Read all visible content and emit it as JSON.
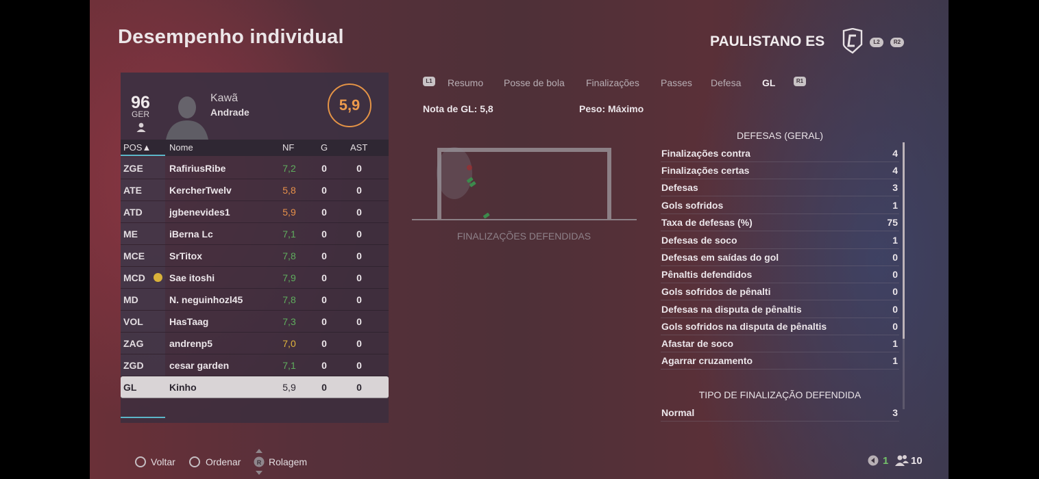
{
  "header": {
    "title": "Desempenho individual",
    "team": "PAULISTANO ES",
    "l2": "L2",
    "r2": "R2"
  },
  "player": {
    "overall": "96",
    "position": "GER",
    "first_name": "Kawã",
    "last_name": "Andrade",
    "rating": "5,9"
  },
  "table": {
    "headers": {
      "pos": "POS▲",
      "name": "Nome",
      "nf": "NF",
      "g": "G",
      "ast": "AST"
    },
    "rows": [
      {
        "pos": "ZGE",
        "name": "RafiriusRibe",
        "nf": "7,2",
        "g": "0",
        "ast": "0"
      },
      {
        "pos": "ATE",
        "name": "KercherTwelv",
        "nf": "5,8",
        "g": "0",
        "ast": "0"
      },
      {
        "pos": "ATD",
        "name": "jgbenevides1",
        "nf": "5,9",
        "g": "0",
        "ast": "0"
      },
      {
        "pos": "ME",
        "name": "iBerna Lc",
        "nf": "7,1",
        "g": "0",
        "ast": "0"
      },
      {
        "pos": "MCE",
        "name": "SrTitox",
        "nf": "7,8",
        "g": "0",
        "ast": "0"
      },
      {
        "pos": "MCD",
        "name": "Sae itoshi",
        "nf": "7,9",
        "g": "0",
        "ast": "0"
      },
      {
        "pos": "MD",
        "name": "N. neguinhozl45",
        "nf": "7,8",
        "g": "0",
        "ast": "0"
      },
      {
        "pos": "VOL",
        "name": "HasTaag",
        "nf": "7,3",
        "g": "0",
        "ast": "0"
      },
      {
        "pos": "ZAG",
        "name": "andrenp5",
        "nf": "7,0",
        "g": "0",
        "ast": "0"
      },
      {
        "pos": "ZGD",
        "name": "cesar garden",
        "nf": "7,1",
        "g": "0",
        "ast": "0"
      },
      {
        "pos": "GL",
        "name": "Kinho",
        "nf": "5,9",
        "g": "0",
        "ast": "0"
      }
    ]
  },
  "colors": {
    "rating_green": "#5fae5e",
    "rating_orange": "#e8914a",
    "rating_yellow": "#e2b63c",
    "accent_teal": "#5cb7c9"
  },
  "tabs": {
    "l1": "L1",
    "r1": "R1",
    "items": [
      "Resumo",
      "Posse de bola",
      "Finalizações",
      "Passes",
      "Defesa",
      "GL"
    ],
    "active": "GL"
  },
  "gk_summary": {
    "note": "Nota de GL: 5,8",
    "weight": "Peso: Máximo"
  },
  "saves_chart_label": "FINALIZAÇÕES DEFENDIDAS",
  "stats": {
    "general_title": "DEFESAS (GERAL)",
    "general": [
      {
        "label": "Finalizações contra",
        "value": "4"
      },
      {
        "label": "Finalizações certas",
        "value": "4"
      },
      {
        "label": "Defesas",
        "value": "3"
      },
      {
        "label": "Gols sofridos",
        "value": "1"
      },
      {
        "label": "Taxa de defesas (%)",
        "value": "75"
      },
      {
        "label": "Defesas de soco",
        "value": "1"
      },
      {
        "label": "Defesas em saídas do gol",
        "value": "0"
      },
      {
        "label": "Pênaltis defendidos",
        "value": "0"
      },
      {
        "label": "Gols sofridos de pênalti",
        "value": "0"
      },
      {
        "label": "Defesas na disputa de pênaltis",
        "value": "0"
      },
      {
        "label": "Gols sofridos na disputa de pênaltis",
        "value": "0"
      },
      {
        "label": "Afastar de soco",
        "value": "1"
      },
      {
        "label": "Agarrar cruzamento",
        "value": "1"
      }
    ],
    "type_title": "TIPO DE FINALIZAÇÃO DEFENDIDA",
    "type": [
      {
        "label": "Normal",
        "value": "3"
      }
    ]
  },
  "footer": {
    "back": "Voltar",
    "sort": "Ordenar",
    "scroll": "Rolagem",
    "count_a": "1",
    "count_b": "10"
  }
}
